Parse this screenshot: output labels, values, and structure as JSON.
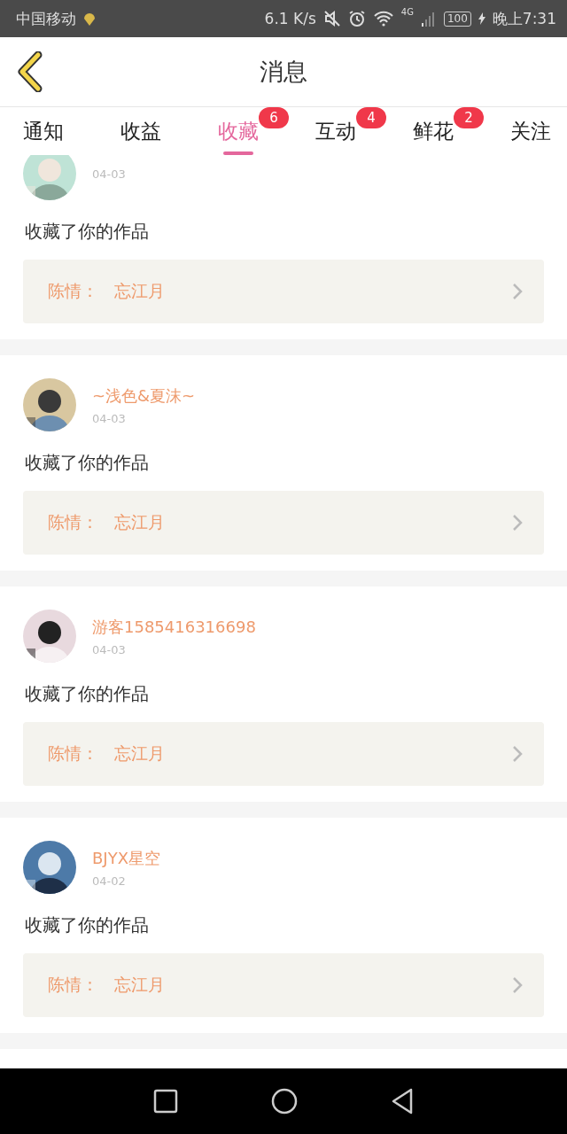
{
  "status_bar": {
    "carrier": "中国移动",
    "speed": "6.1 K/s",
    "network": "4G",
    "battery": "100",
    "time": "晚上7:31"
  },
  "header": {
    "title": "消息"
  },
  "tabs": [
    {
      "label": "通知",
      "selected": false
    },
    {
      "label": "收益",
      "selected": false
    },
    {
      "label": "收藏",
      "selected": true,
      "badge": "6"
    },
    {
      "label": "互动",
      "selected": false,
      "badge": "4"
    },
    {
      "label": "鲜花",
      "selected": false,
      "badge": "2"
    },
    {
      "label": "关注",
      "selected": false
    }
  ],
  "messages": [
    {
      "date": "04-03",
      "action": "收藏了你的作品",
      "work": "陈情：",
      "title": "忘江月"
    },
    {
      "name": "~浅色&夏沫~",
      "date": "04-03",
      "action": "收藏了你的作品",
      "work": "陈情：",
      "title": "忘江月"
    },
    {
      "name": "游客1585416316698",
      "date": "04-03",
      "action": "收藏了你的作品",
      "work": "陈情：",
      "title": "忘江月"
    },
    {
      "name": "BJYX星空",
      "date": "04-02",
      "action": "收藏了你的作品",
      "work": "陈情：",
      "title": "忘江月"
    }
  ]
}
